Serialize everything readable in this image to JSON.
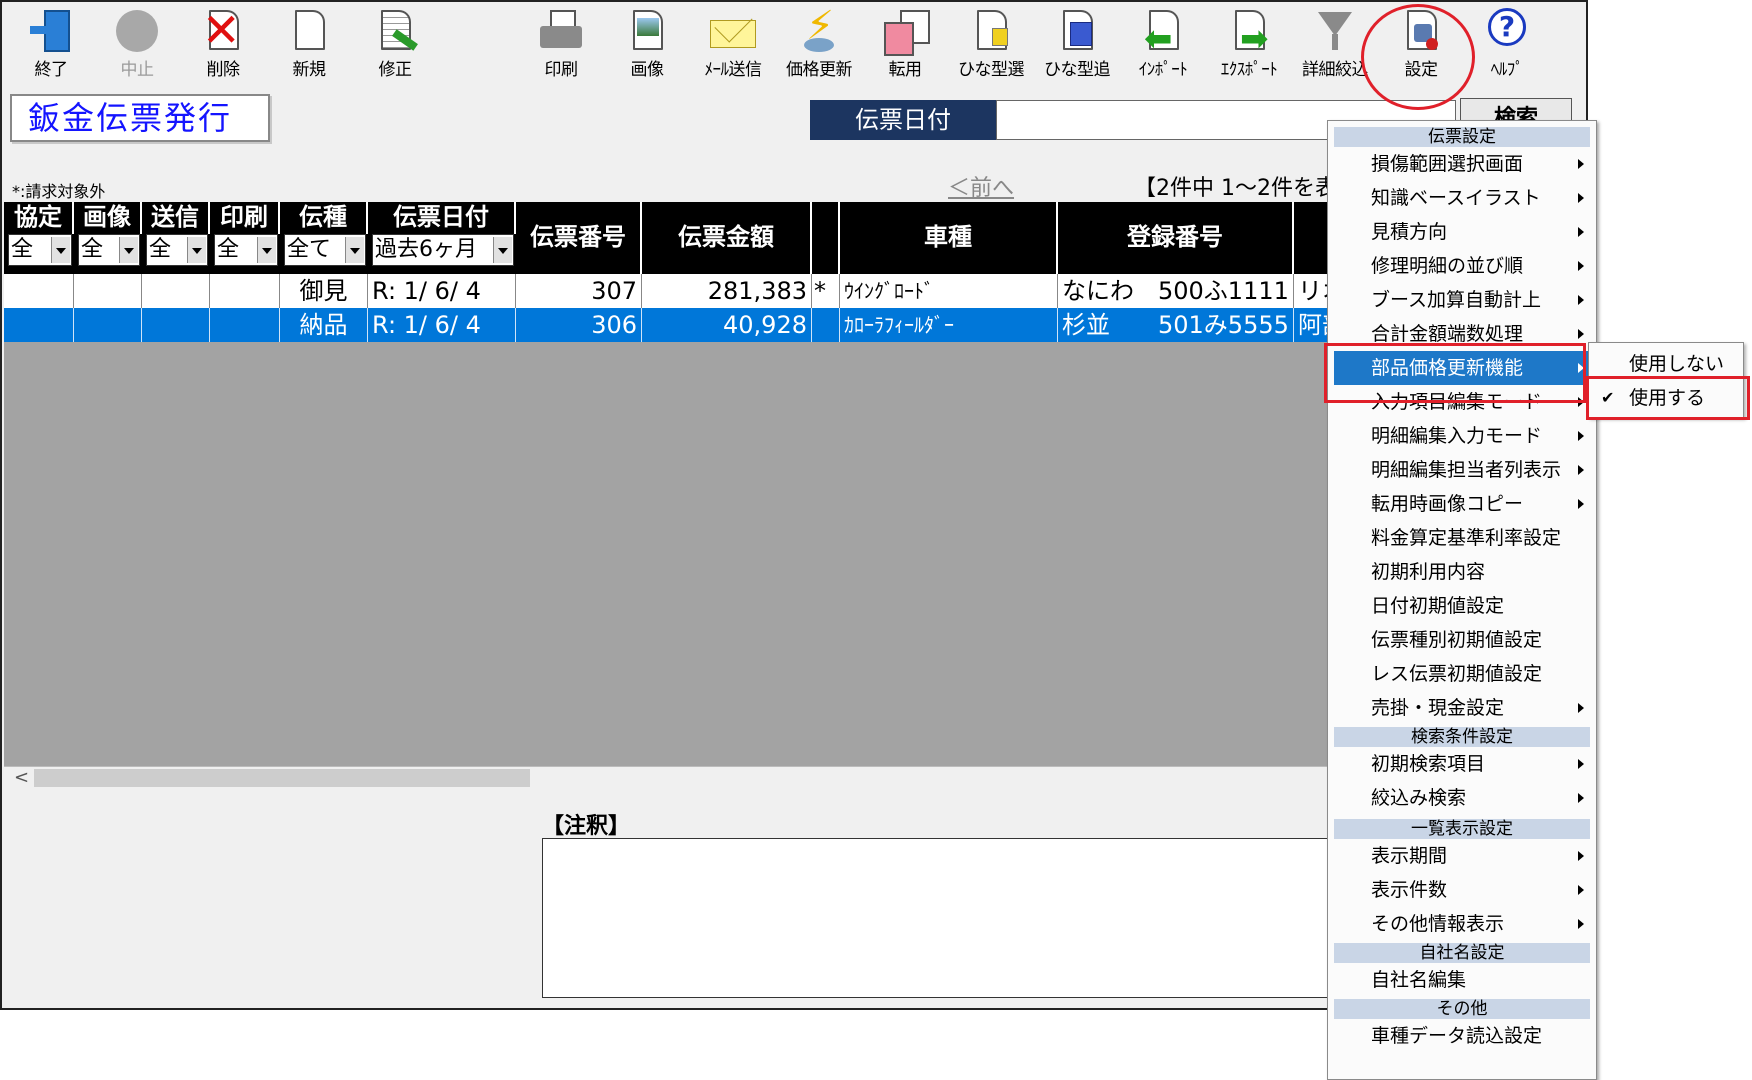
{
  "toolbar": {
    "end": "終了",
    "stop": "中止",
    "delete": "削除",
    "new": "新規",
    "edit": "修正",
    "print": "印刷",
    "image": "画像",
    "mail_send": "ﾒｰﾙ送信",
    "price_update": "価格更新",
    "transfer": "転用",
    "template_select": "ひな型選",
    "template_add": "ひな型追",
    "import": "ｲﾝﾎﾟｰﾄ",
    "export": "ｴｸｽﾎﾟｰﾄ",
    "detail_filter": "詳細絞込",
    "settings": "設定",
    "help": "ﾍﾙﾌﾟ"
  },
  "window": {
    "title": "鈑金伝票発行"
  },
  "search": {
    "date_label": "伝票日付",
    "button": "検索"
  },
  "list": {
    "note": "*:請求対象外",
    "prev": "＜前へ",
    "count": "【2件中 1～2件を表",
    "headers": {
      "kyotei": "協定",
      "gazo": "画像",
      "soshin": "送信",
      "insatsu": "印刷",
      "denshu": "伝種",
      "date": "伝票日付",
      "number": "伝票番号",
      "amount": "伝票金額",
      "car": "車種",
      "reg": "登録番号"
    },
    "filters": {
      "kyotei": "全",
      "gazo": "全",
      "soshin": "全",
      "insatsu": "全",
      "denshu": "全て",
      "date": "過去6ヶ月"
    },
    "rows": [
      {
        "type": "御見",
        "date": "R:  1/ 6/ 4",
        "number": "307",
        "amount": "281,383",
        "mark": "*",
        "car": "ｳｲﾝｸﾞﾛｰﾄﾞ",
        "reg_area": "なにわ",
        "reg_num": "500ふ1111",
        "extra": "リオ"
      },
      {
        "type": "納品",
        "date": "R:  1/ 6/ 4",
        "number": "306",
        "amount": "40,928",
        "mark": "",
        "car": "ｶﾛｰﾗﾌｨｰﾙﾀﾞｰ",
        "reg_area": "杉並",
        "reg_num": "501み5555",
        "extra": "阿部"
      }
    ]
  },
  "annotation": {
    "label": "【注釈】"
  },
  "menu": {
    "sec1": "伝票設定",
    "items1": [
      "損傷範囲選択画面",
      "知識ベースイラスト",
      "見積方向",
      "修理明細の並び順",
      "ブース加算自動計上",
      "合計金額端数処理",
      "部品価格更新機能",
      "入力項目編集モード",
      "明細編集入力モード",
      "明細編集担当者列表示",
      "転用時画像コピー",
      "料金算定基準利率設定",
      "初期利用内容",
      "日付初期値設定",
      "伝票種別初期値設定",
      "レス伝票初期値設定",
      "売掛・現金設定"
    ],
    "sec2": "検索条件設定",
    "items2": [
      "初期検索項目",
      "絞込み検索"
    ],
    "sec3": "一覧表示設定",
    "items3": [
      "表示期間",
      "表示件数",
      "その他情報表示"
    ],
    "sec4": "自社名設定",
    "items4": [
      "自社名編集"
    ],
    "sec5": "その他",
    "items5": [
      "車種データ読込設定"
    ]
  },
  "submenu": {
    "unused": "使用しない",
    "use": "使用する",
    "check": "✔"
  },
  "colors": {
    "accent": "#1e78c8",
    "selected_row": "#0077d9",
    "annotation_red": "#e0202a",
    "header_bg": "#000000"
  }
}
